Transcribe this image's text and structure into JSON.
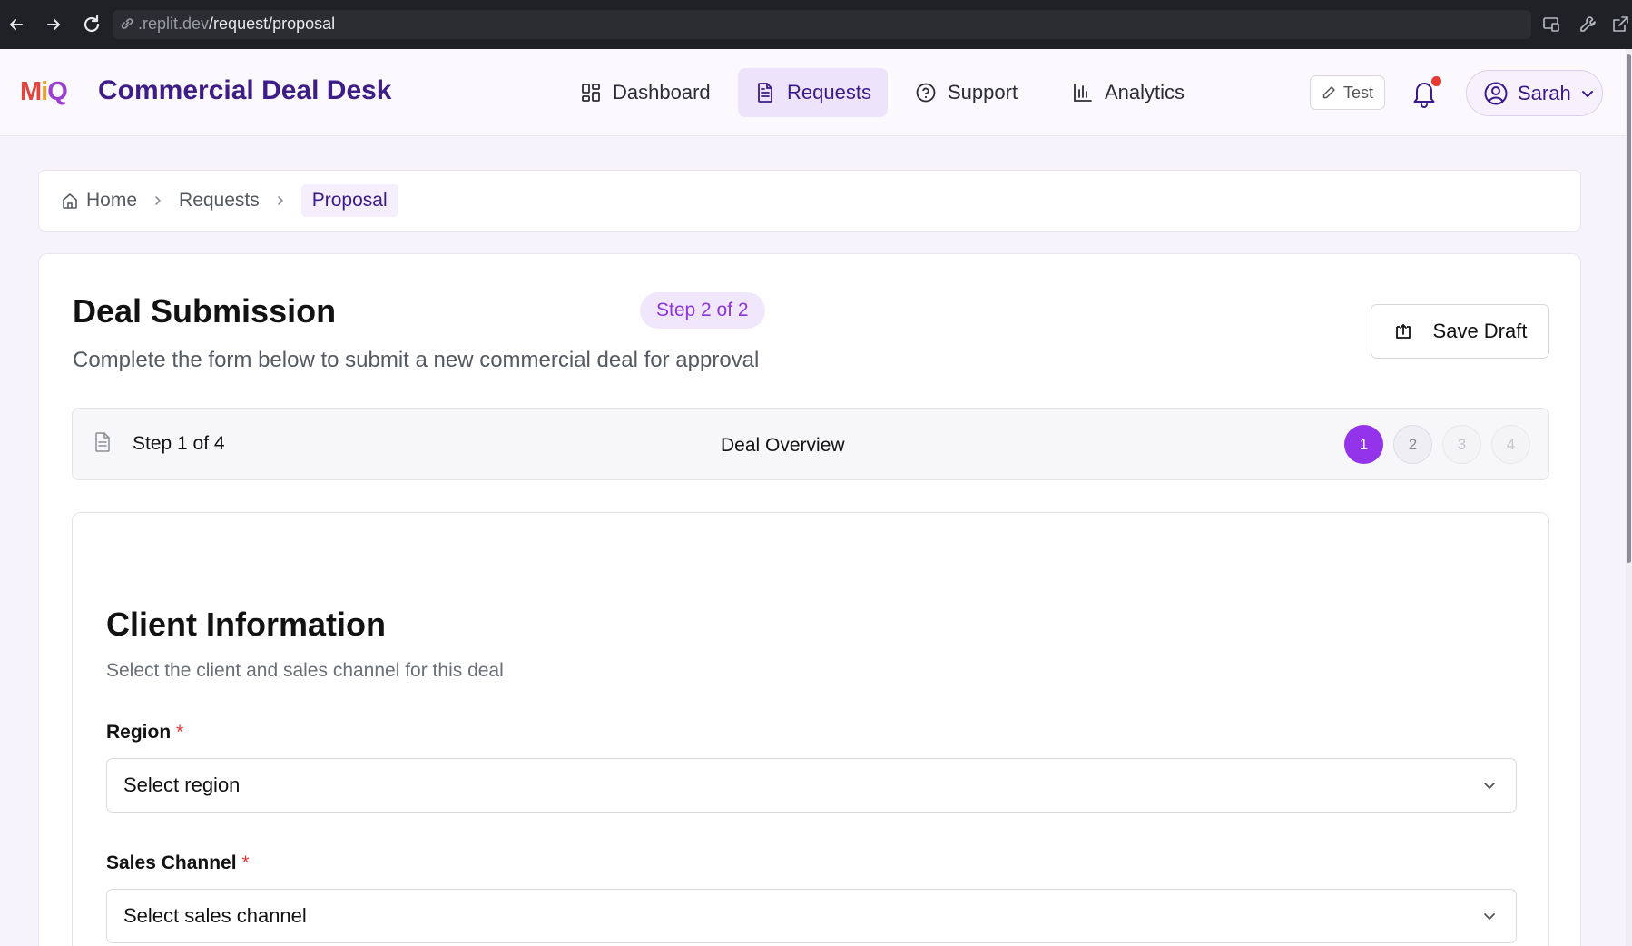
{
  "browser": {
    "url_host": ".replit.dev",
    "url_path": "/request/proposal"
  },
  "header": {
    "logo": {
      "part1": "M",
      "part2": "i",
      "part3": "Q"
    },
    "title": "Commercial Deal Desk",
    "nav": [
      {
        "label": "Dashboard",
        "icon": "grid-icon"
      },
      {
        "label": "Requests",
        "icon": "document-icon",
        "active": true
      },
      {
        "label": "Support",
        "icon": "help-circle-icon"
      },
      {
        "label": "Analytics",
        "icon": "bar-chart-icon"
      }
    ],
    "test_label": "Test",
    "user_name": "Sarah"
  },
  "breadcrumb": {
    "items": [
      "Home",
      "Requests",
      "Proposal"
    ]
  },
  "page": {
    "title": "Deal Submission",
    "step_badge": "Step 2 of 2",
    "subtitle": "Complete the form below to submit a new commercial deal for approval",
    "save_draft_label": "Save Draft"
  },
  "progress": {
    "step_count": "Step 1 of 4",
    "step_name": "Deal Overview",
    "steps": [
      "1",
      "2",
      "3",
      "4"
    ],
    "current_step": 1
  },
  "form": {
    "section_title": "Client Information",
    "section_desc": "Select the client and sales channel for this deal",
    "fields": [
      {
        "label": "Region",
        "required_mark": "*",
        "placeholder": "Select region"
      },
      {
        "label": "Sales Channel",
        "required_mark": "*",
        "placeholder": "Select sales channel"
      }
    ]
  },
  "colors": {
    "brand_purple": "#3e1e86",
    "accent_purple": "#9333ea",
    "required_red": "#e53935"
  }
}
